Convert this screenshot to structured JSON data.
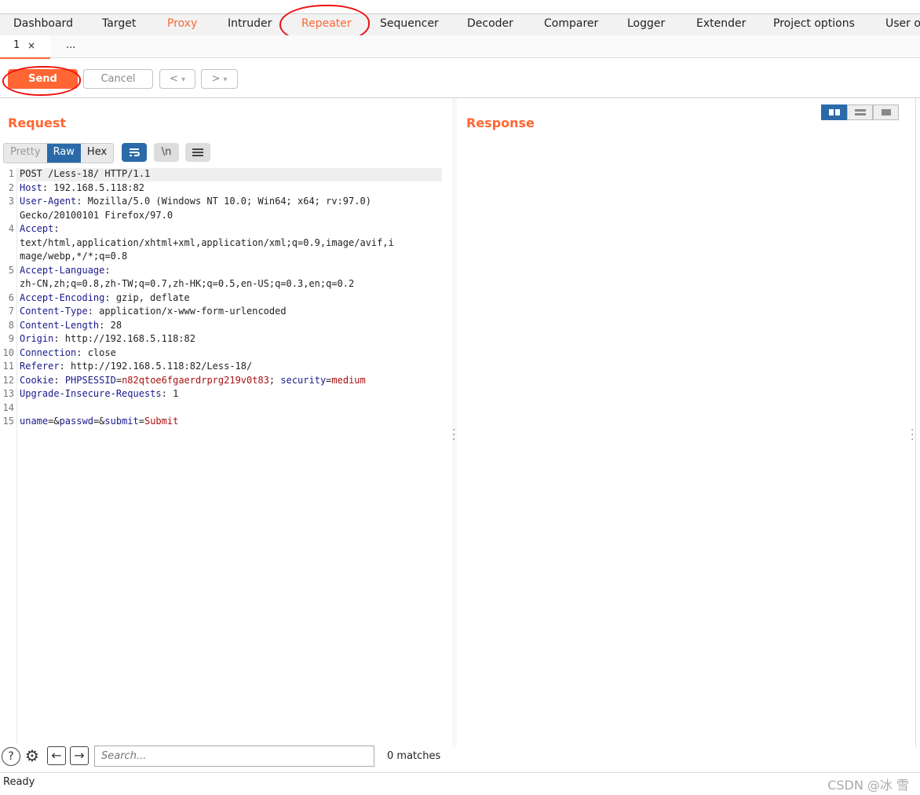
{
  "main_tabs": [
    "Dashboard",
    "Target",
    "Proxy",
    "Intruder",
    "Repeater",
    "Sequencer",
    "Decoder",
    "Comparer",
    "Logger",
    "Extender",
    "Project options",
    "User op"
  ],
  "sub_tabs": {
    "tab1": "1",
    "close": "×",
    "more": "..."
  },
  "toolbar": {
    "send": "Send",
    "cancel": "Cancel",
    "back": "<",
    "forward": ">",
    "dropdown": "▾"
  },
  "request": {
    "title": "Request",
    "view_tabs": {
      "pretty": "Pretty",
      "raw": "Raw",
      "hex": "Hex"
    },
    "icons": {
      "wrap": "wrap-lines-icon",
      "newline": "\\n",
      "menu": "menu-icon"
    },
    "lines": [
      {
        "n": "1",
        "segments": [
          {
            "t": "POST /Less-18/ HTTP/1.1",
            "c": ""
          }
        ]
      },
      {
        "n": "2",
        "segments": [
          {
            "t": "Host",
            "c": "hdr"
          },
          {
            "t": ": 192.168.5.118:82",
            "c": ""
          }
        ]
      },
      {
        "n": "3",
        "segments": [
          {
            "t": "User-Agent",
            "c": "hdr"
          },
          {
            "t": ": Mozilla/5.0 (Windows NT 10.0; Win64; x64; rv:97.0)",
            "c": ""
          }
        ]
      },
      {
        "n": "",
        "segments": [
          {
            "t": "Gecko/20100101 Firefox/97.0",
            "c": ""
          }
        ]
      },
      {
        "n": "4",
        "segments": [
          {
            "t": "Accept",
            "c": "hdr"
          },
          {
            "t": ":",
            "c": ""
          }
        ]
      },
      {
        "n": "",
        "segments": [
          {
            "t": "text/html,application/xhtml+xml,application/xml;q=0.9,image/avif,i",
            "c": ""
          }
        ]
      },
      {
        "n": "",
        "segments": [
          {
            "t": "mage/webp,*/*;q=0.8",
            "c": ""
          }
        ]
      },
      {
        "n": "5",
        "segments": [
          {
            "t": "Accept-Language",
            "c": "hdr"
          },
          {
            "t": ":",
            "c": ""
          }
        ]
      },
      {
        "n": "",
        "segments": [
          {
            "t": "zh-CN,zh;q=0.8,zh-TW;q=0.7,zh-HK;q=0.5,en-US;q=0.3,en;q=0.2",
            "c": ""
          }
        ]
      },
      {
        "n": "6",
        "segments": [
          {
            "t": "Accept-Encoding",
            "c": "hdr"
          },
          {
            "t": ": gzip, deflate",
            "c": ""
          }
        ]
      },
      {
        "n": "7",
        "segments": [
          {
            "t": "Content-Type",
            "c": "hdr"
          },
          {
            "t": ": application/x-www-form-urlencoded",
            "c": ""
          }
        ]
      },
      {
        "n": "8",
        "segments": [
          {
            "t": "Content-Length",
            "c": "hdr"
          },
          {
            "t": ": 28",
            "c": ""
          }
        ]
      },
      {
        "n": "9",
        "segments": [
          {
            "t": "Origin",
            "c": "hdr"
          },
          {
            "t": ": http://192.168.5.118:82",
            "c": ""
          }
        ]
      },
      {
        "n": "10",
        "segments": [
          {
            "t": "Connection",
            "c": "hdr"
          },
          {
            "t": ": close",
            "c": ""
          }
        ]
      },
      {
        "n": "11",
        "segments": [
          {
            "t": "Referer",
            "c": "hdr"
          },
          {
            "t": ": http://192.168.5.118:82/Less-18/",
            "c": ""
          }
        ]
      },
      {
        "n": "12",
        "segments": [
          {
            "t": "Cookie",
            "c": "hdr"
          },
          {
            "t": ": ",
            "c": ""
          },
          {
            "t": "PHPSESSID",
            "c": "hdr"
          },
          {
            "t": "=",
            "c": ""
          },
          {
            "t": "n82qtoe6fgaerdrprg219v0t83",
            "c": "val"
          },
          {
            "t": "; ",
            "c": ""
          },
          {
            "t": "security",
            "c": "hdr"
          },
          {
            "t": "=",
            "c": ""
          },
          {
            "t": "medium",
            "c": "val"
          }
        ]
      },
      {
        "n": "13",
        "segments": [
          {
            "t": "Upgrade-Insecure-Requests",
            "c": "hdr"
          },
          {
            "t": ": 1",
            "c": ""
          }
        ]
      },
      {
        "n": "14",
        "segments": []
      },
      {
        "n": "15",
        "segments": [
          {
            "t": "uname",
            "c": "hdr"
          },
          {
            "t": "=&",
            "c": ""
          },
          {
            "t": "passwd",
            "c": "hdr"
          },
          {
            "t": "=&",
            "c": ""
          },
          {
            "t": "submit",
            "c": "hdr"
          },
          {
            "t": "=",
            "c": ""
          },
          {
            "t": "Submit",
            "c": "val"
          }
        ]
      }
    ]
  },
  "response": {
    "title": "Response"
  },
  "search": {
    "help": "?",
    "settings": "⚙",
    "prev": "←",
    "next": "→",
    "placeholder": "Search...",
    "matches": "0 matches"
  },
  "status": {
    "text": "Ready"
  },
  "watermark": "CSDN @冰 雪",
  "colors": {
    "accent": "#ff6633",
    "selected": "#2b6aa8",
    "annotation": "#ee1111"
  }
}
